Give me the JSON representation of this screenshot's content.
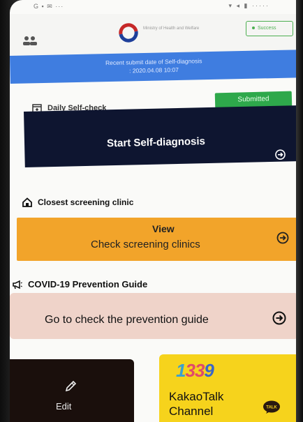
{
  "status_bar": {
    "left": "G ▪ ✉ ···",
    "right": "▾ ◂ ▮ ·····"
  },
  "header": {
    "logo_text": "Ministry of Health and Welfare",
    "success_label": "Success"
  },
  "banner": {
    "line1": "Recent submit date of Self-diagnosis",
    "line2": ": 2020.04.08 10:07"
  },
  "daily": {
    "label": "Daily Self-check",
    "badge": "Submitted",
    "card_label": "Start Self-diagnosis"
  },
  "clinic": {
    "label": "Closest screening clinic",
    "title": "View",
    "subtitle": "Check screening clinics"
  },
  "guide": {
    "label": "COVID-19 Prevention Guide",
    "card_label": "Go to check the prevention guide"
  },
  "edit": {
    "label": "Edit"
  },
  "kakao": {
    "number_digits": [
      "1",
      "3",
      "3",
      "9"
    ],
    "label_line1": "KakaoTalk",
    "label_line2": "Channel",
    "bubble": "TALK"
  },
  "colors": {
    "banner": "#3f7de0",
    "submitted": "#2ea84b",
    "start_card": "#0e1530",
    "clinic_card": "#f2a42a",
    "guide_card": "#efd3c9",
    "kakao": "#f6d31c"
  },
  "icons": [
    "menu-icon",
    "logo-icon",
    "calendar-icon",
    "home-icon",
    "megaphone-icon",
    "arrow-right-circle-icon",
    "pencil-icon",
    "talk-bubble-icon"
  ]
}
